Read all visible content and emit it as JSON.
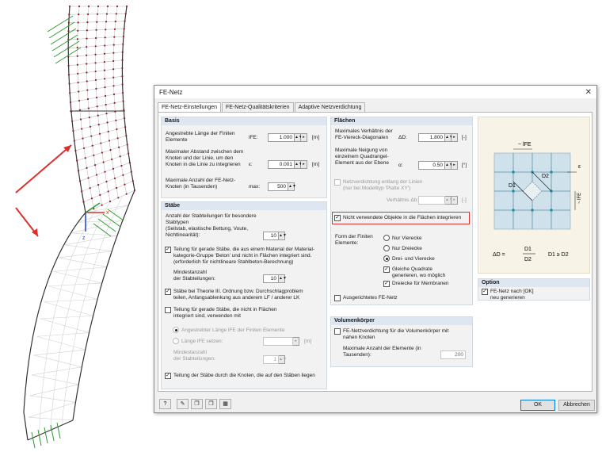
{
  "window": {
    "title": "FE-Netz"
  },
  "tabs": [
    "FE-Netz-Einstellungen",
    "FE-Netz-Qualitätskriterien",
    "Adaptive Netzverdichtung"
  ],
  "basis": {
    "header": "Basis",
    "r1_l1": "Angestrebte Länge der Finiten",
    "r1_l2": "Elemente",
    "r1_sym": "lFE:",
    "r1_val": "1.000",
    "r1_unit": "[m]",
    "r2_l1": "Maximaler Abstand zwischen dem",
    "r2_l2": "Knoten und der Linie, um den",
    "r2_l3": "Knoten in die Linie zu integrieren",
    "r2_sym": "ε:",
    "r2_val": "0.001",
    "r2_unit": "[m]",
    "r3_l1": "Maximale Anzahl der FE-Netz-",
    "r3_l2": "Knoten (in Tausenden)",
    "r3_sym": "max:",
    "r3_val": "500"
  },
  "staebe": {
    "header": "Stäbe",
    "div_l1": "Anzahl der Stabteilungen für besondere",
    "div_l2": "Stabtypen",
    "div_l3": "(Seilstab, elastische Bettung, Voute,",
    "div_l4": "Nichtlinearität):",
    "div_val": "10",
    "cb1_l1": "Teilung für gerade Stäbe, die aus einem Material der Material-",
    "cb1_l2": "kategorie-Gruppe 'Beton' und nicht in Flächen integriert sind.",
    "cb1_l3": "(erforderlich für nichtlineare Stahlbeton-Berechnung)",
    "min1_l1": "Mindestanzahl",
    "min1_l2": "der Stabteilungen:",
    "min1_val": "10",
    "cb2_l1": "Stäbe bei Theorie III. Ordnung bzw. Durchschlagproblem",
    "cb2_l2": "teilen, Anfangsablenkung aus anderem LF / anderer LK",
    "cb3_l1": "Teilung für gerade Stäbe, die nicht in Flächen",
    "cb3_l2": "integriert sind, verwenden mit",
    "rad1": "Angestrebter Länge lFE der Finiten Elemente",
    "rad2": "Länge lFE setzen:",
    "rad2_unit": "[m]",
    "min2_l1": "Mindestanzahl",
    "min2_l2": "der Stabteilungen:",
    "min2_val": "1",
    "cb4": "Teilung der Stäbe durch die Knoten, die auf den Stäben liegen"
  },
  "flaechen": {
    "header": "Flächen",
    "r1_l1": "Maximales Verhältnis der",
    "r1_l2": "FE-Viereck-Diagonalen",
    "r1_sym": "ΔD:",
    "r1_val": "1.800",
    "r1_unit": "[-]",
    "r2_l1": "Maximale Neigung von",
    "r2_l2": "einzelnem Quadrangel-",
    "r2_l3": "Element aus der Ebene",
    "r2_sym": "α:",
    "r2_val": "0.50",
    "r2_unit": "[°]",
    "cb1_l1": "Netzverdichtung entlang der Linien",
    "cb1_l2": "(nur bei Modelltyp 'Platte XY')",
    "ratio_lbl": "Verhältnis Δb:",
    "ratio_unit": "[-]",
    "cb2": "Nicht verwendete Objekte in die Flächen integrieren",
    "form_l1": "Form der Finiten",
    "form_l2": "Elemente:",
    "o1": "Nur Vierecke",
    "o2": "Nur Dreiecke",
    "o3": "Drei- und Vierecke",
    "sub1_l1": "Gleiche Quadrate",
    "sub1_l2": "generieren, wo möglich",
    "sub2": "Dreiecke für Membranen",
    "cb3": "Ausgerichtetes FE-Netz"
  },
  "volumen": {
    "header": "Volumenkörper",
    "cb_l1": "FE-Netzverdichtung für die Volumenkörper mit",
    "cb_l2": "nahen Knoten",
    "max_l1": "Maximale Anzahl der Elemente (in",
    "max_l2": "Tausenden):",
    "max_val": "200"
  },
  "diagram": {
    "lfe": "~ lFE",
    "eps": "ε",
    "d1": "D1",
    "d2": "D2",
    "delta": "ΔD =",
    "frac_num": "D1",
    "frac_den": "D2",
    "cond": "D1 ≥ D2"
  },
  "option": {
    "header": "Option",
    "cb_l1": "FE-Netz nach [OK]",
    "cb_l2": "neu generieren"
  },
  "footer": {
    "ok": "OK",
    "cancel": "Abbrechen"
  },
  "axes": {
    "x": "x",
    "z": "z"
  },
  "colors": {
    "accent": "#d9312b",
    "mesh": "#b9b9b9",
    "node": "#8a1a2a",
    "support": "#2e9b2e"
  }
}
